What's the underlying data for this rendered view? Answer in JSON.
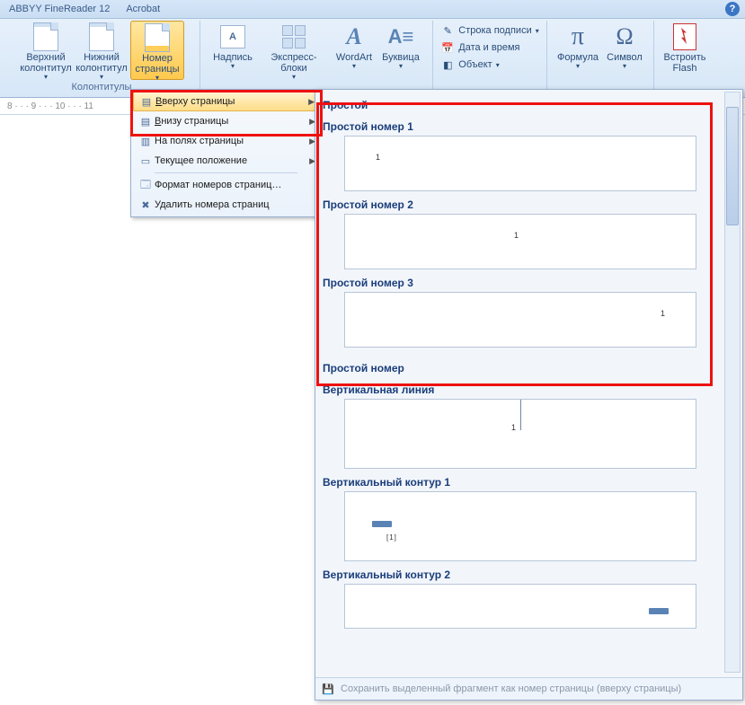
{
  "tabs": {
    "abbyy": "ABBYY FineReader 12",
    "acrobat": "Acrobat"
  },
  "ribbon": {
    "header_footer_top": "Верхний колонтитул",
    "header_footer_bottom": "Нижний колонтитул",
    "page_number": "Номер страницы",
    "group1": "Колонтитулы",
    "textbox": "Надпись",
    "quick_parts": "Экспресс-блоки",
    "wordart": "WordArt",
    "dropcap": "Буквица",
    "sig_line": "Строка подписи",
    "date_time": "Дата и время",
    "object": "Объект",
    "formula": "Формула",
    "symbol": "Символ",
    "flash": "Встроить Flash"
  },
  "ruler": "8 · · · 9 · · · 10 · · · 11",
  "menu": {
    "top": "Вверху страницы",
    "bottom": "Внизу страницы",
    "margins": "На полях страницы",
    "current": "Текущее положение",
    "format": "Формат номеров страниц…",
    "remove": "Удалить номера страниц"
  },
  "gallery": {
    "h1": "Простой",
    "i1": "Простой номер 1",
    "i2": "Простой номер 2",
    "i3": "Простой номер 3",
    "h2": "Простой номер",
    "i4": "Вертикальная линия",
    "i5": "Вертикальный контур 1",
    "i6": "Вертикальный контур 2",
    "footer": "Сохранить выделенный фрагмент как номер страницы (вверху страницы)"
  }
}
